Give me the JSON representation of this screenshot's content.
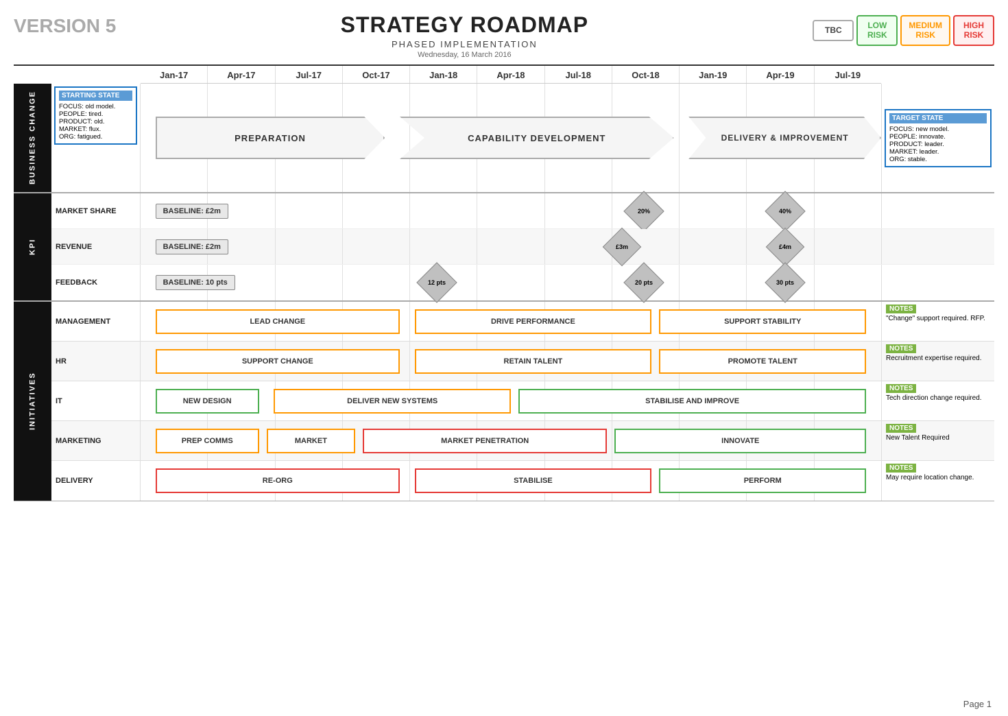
{
  "header": {
    "version": "VERSION 5",
    "title": "STRATEGY ROADMAP",
    "subtitle": "PHASED IMPLEMENTATION",
    "date": "Wednesday, 16 March 2016"
  },
  "risk_badges": [
    {
      "label": "TBC",
      "type": "tbc"
    },
    {
      "label": "LOW\nRISK",
      "type": "low"
    },
    {
      "label": "MEDIUM\nRISK",
      "type": "medium"
    },
    {
      "label": "HIGH\nRISK",
      "type": "high"
    }
  ],
  "timeline": [
    "Jan-17",
    "Apr-17",
    "Jul-17",
    "Oct-17",
    "Jan-18",
    "Apr-18",
    "Jul-18",
    "Oct-18",
    "Jan-19",
    "Apr-19",
    "Jul-19"
  ],
  "business_change": {
    "label": "BUSINESS CHANGE",
    "starting_state": {
      "title": "STARTING STATE",
      "lines": [
        "FOCUS: old model.",
        "PEOPLE: tired.",
        "PRODUCT: old.",
        "MARKET: flux.",
        "ORG: fatigued."
      ]
    },
    "target_state": {
      "title": "TARGET STATE",
      "lines": [
        "FOCUS: new model.",
        "PEOPLE: innovate.",
        "PRODUCT: leader.",
        "MARKET: leader.",
        "ORG: stable."
      ]
    },
    "phases": [
      {
        "label": "PREPARATION",
        "span_start": 1,
        "span_end": 3
      },
      {
        "label": "CAPABILITY DEVELOPMENT",
        "span_start": 3,
        "span_end": 7
      },
      {
        "label": "DELIVERY & IMPROVEMENT",
        "span_start": 7,
        "span_end": 10
      }
    ]
  },
  "kpi": {
    "label": "KPI",
    "rows": [
      {
        "label": "MARKET SHARE",
        "baseline": "BASELINE: £2m",
        "milestones": [
          {
            "label": "20%",
            "col_offset": 7.5
          },
          {
            "label": "40%",
            "col_offset": 9.5
          }
        ]
      },
      {
        "label": "REVENUE",
        "baseline": "BASELINE: £2m",
        "milestones": [
          {
            "label": "£3m",
            "col_offset": 7.2
          },
          {
            "label": "£4m",
            "col_offset": 9.5
          }
        ]
      },
      {
        "label": "FEEDBACK",
        "baseline": "BASELINE: 10 pts",
        "milestones": [
          {
            "label": "12 pts",
            "col_offset": 4.8
          },
          {
            "label": "20 pts",
            "col_offset": 7.7
          },
          {
            "label": "30 pts",
            "col_offset": 9.5
          }
        ]
      }
    ]
  },
  "initiatives": {
    "label": "INITIATIVES",
    "rows": [
      {
        "label": "MANAGEMENT",
        "boxes": [
          {
            "text": "LEAD CHANGE",
            "start_pct": 4.5,
            "end_pct": 36,
            "style": "orange"
          },
          {
            "text": "DRIVE PERFORMANCE",
            "start_pct": 38,
            "end_pct": 68,
            "style": "orange"
          },
          {
            "text": "SUPPORT STABILITY",
            "start_pct": 70,
            "end_pct": 96,
            "style": "orange"
          }
        ],
        "notes_badge": "NOTES",
        "notes_text": "\"Change\" support required. RFP."
      },
      {
        "label": "HR",
        "boxes": [
          {
            "text": "SUPPORT CHANGE",
            "start_pct": 4.5,
            "end_pct": 36,
            "style": "orange"
          },
          {
            "text": "RETAIN TALENT",
            "start_pct": 38,
            "end_pct": 68,
            "style": "orange"
          },
          {
            "text": "PROMOTE TALENT",
            "start_pct": 70,
            "end_pct": 96,
            "style": "orange"
          }
        ],
        "notes_badge": "NOTES",
        "notes_text": "Recruitment expertise required."
      },
      {
        "label": "IT",
        "boxes": [
          {
            "text": "NEW DESIGN",
            "start_pct": 4.5,
            "end_pct": 18,
            "style": "green"
          },
          {
            "text": "DELIVER NEW SYSTEMS",
            "start_pct": 20,
            "end_pct": 50,
            "style": "orange"
          },
          {
            "text": "STABILISE AND IMPROVE",
            "start_pct": 52,
            "end_pct": 96,
            "style": "green"
          }
        ],
        "notes_badge": "NOTES",
        "notes_text": "Tech direction change required."
      },
      {
        "label": "MARKETING",
        "boxes": [
          {
            "text": "PREP COMMS",
            "start_pct": 4.5,
            "end_pct": 18,
            "style": "orange"
          },
          {
            "text": "MARKET",
            "start_pct": 20,
            "end_pct": 32,
            "style": "orange"
          },
          {
            "text": "MARKET PENETRATION",
            "start_pct": 34,
            "end_pct": 65,
            "style": "red"
          },
          {
            "text": "INNOVATE",
            "start_pct": 67,
            "end_pct": 96,
            "style": "green"
          }
        ],
        "notes_badge": "NOTES",
        "notes_text": "New Talent Required"
      },
      {
        "label": "DELIVERY",
        "boxes": [
          {
            "text": "RE-ORG",
            "start_pct": 4.5,
            "end_pct": 36,
            "style": "red"
          },
          {
            "text": "STABILISE",
            "start_pct": 38,
            "end_pct": 68,
            "style": "red"
          },
          {
            "text": "PERFORM",
            "start_pct": 70,
            "end_pct": 96,
            "style": "green"
          }
        ],
        "notes_badge": "NOTES",
        "notes_text": "May require location change."
      }
    ]
  },
  "page": "Page 1"
}
